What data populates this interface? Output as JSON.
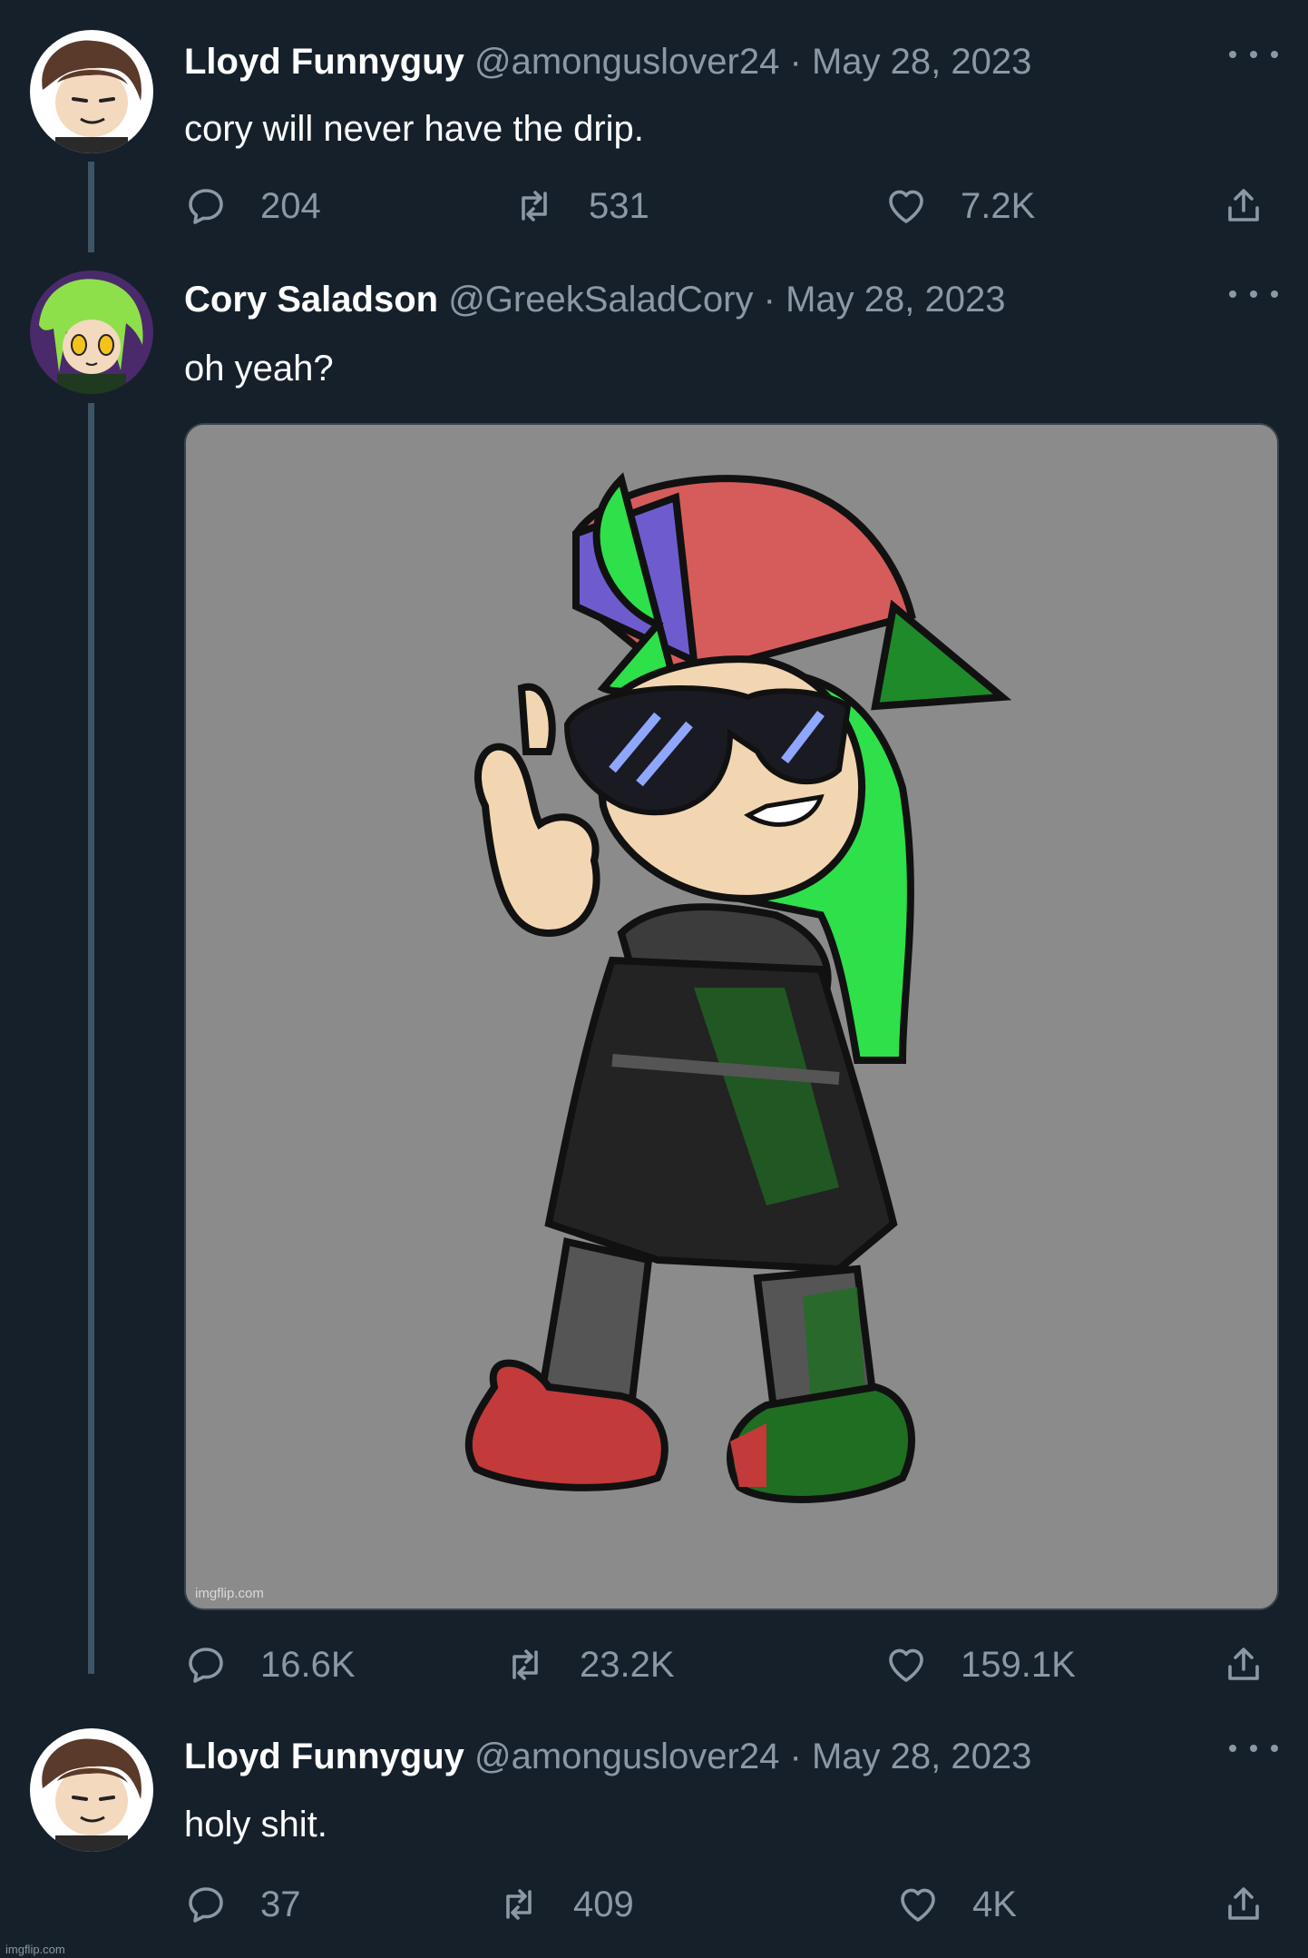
{
  "tweets": [
    {
      "name": "Lloyd Funnyguy",
      "handle": "@amonguslover24",
      "separator": "·",
      "date": "May 28, 2023",
      "text": "cory will never have the drip.",
      "replies": "204",
      "retweets": "531",
      "likes": "7.2K"
    },
    {
      "name": "Cory Saladson",
      "handle": "@GreekSaladCory",
      "separator": "·",
      "date": "May 28, 2023",
      "text": "oh yeah?",
      "replies": "16.6K",
      "retweets": "23.2K",
      "likes": "159.1K",
      "media_watermark": "imgflip.com"
    },
    {
      "name": "Lloyd Funnyguy",
      "handle": "@amonguslover24",
      "separator": "·",
      "date": "May 28, 2023",
      "text": "holy shit.",
      "replies": "37",
      "retweets": "409",
      "likes": "4K"
    }
  ],
  "footer_watermark": "imgflip.com",
  "icons": [
    "more-icon",
    "reply-icon",
    "retweet-icon",
    "like-icon",
    "share-icon"
  ],
  "colors": {
    "background": "#15202b",
    "secondary_text": "#8b98a5",
    "thread_line": "#3d5466"
  }
}
